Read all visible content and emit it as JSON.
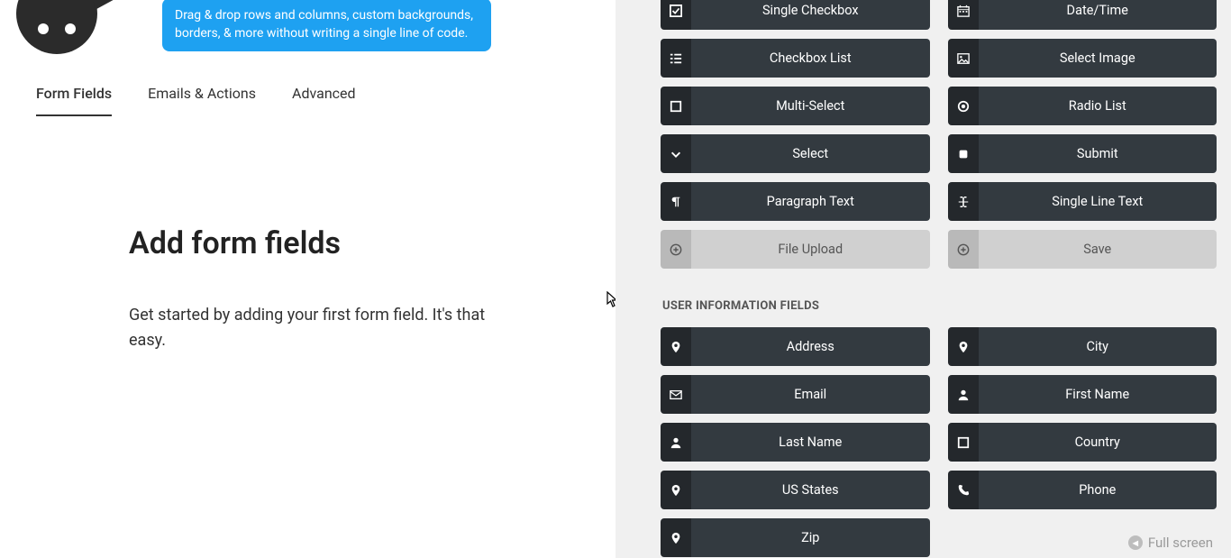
{
  "tooltip": "Drag & drop rows and columns, custom backgrounds, borders, & more without writing a single line of code.",
  "tabs": {
    "formFields": "Form Fields",
    "emailsActions": "Emails & Actions",
    "advanced": "Advanced"
  },
  "main": {
    "heading": "Add form fields",
    "paragraph": "Get started by adding your first form field. It's that easy."
  },
  "commonFields": [
    {
      "label": "Single Checkbox",
      "icon": "check-square"
    },
    {
      "label": "Date/Time",
      "icon": "calendar"
    },
    {
      "label": "Checkbox List",
      "icon": "list"
    },
    {
      "label": "Select Image",
      "icon": "image"
    },
    {
      "label": "Multi-Select",
      "icon": "square"
    },
    {
      "label": "Radio List",
      "icon": "dot"
    },
    {
      "label": "Select",
      "icon": "chevron-down"
    },
    {
      "label": "Submit",
      "icon": "square-fill"
    },
    {
      "label": "Paragraph Text",
      "icon": "pilcrow"
    },
    {
      "label": "Single Line Text",
      "icon": "text-cursor"
    },
    {
      "label": "File Upload",
      "icon": "plus-circle",
      "disabled": true
    },
    {
      "label": "Save",
      "icon": "plus-circle",
      "disabled": true
    }
  ],
  "userFieldsTitle": "USER INFORMATION FIELDS",
  "userFields": [
    {
      "label": "Address",
      "icon": "pin"
    },
    {
      "label": "City",
      "icon": "pin"
    },
    {
      "label": "Email",
      "icon": "envelope"
    },
    {
      "label": "First Name",
      "icon": "user"
    },
    {
      "label": "Last Name",
      "icon": "user"
    },
    {
      "label": "Country",
      "icon": "square"
    },
    {
      "label": "US States",
      "icon": "pin"
    },
    {
      "label": "Phone",
      "icon": "phone"
    },
    {
      "label": "Zip",
      "icon": "pin"
    }
  ],
  "fullscreen": "Full screen"
}
